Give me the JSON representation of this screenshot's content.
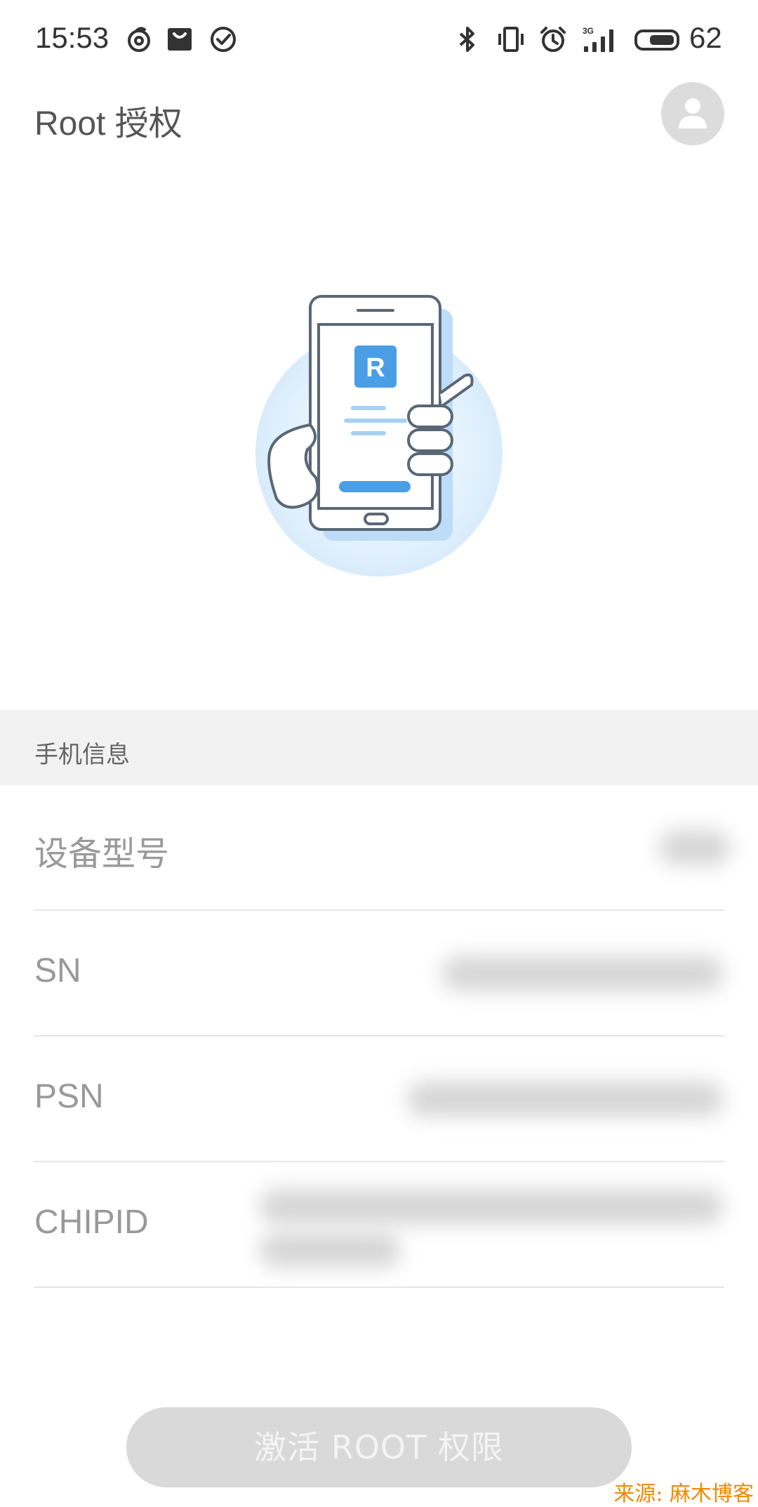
{
  "status_bar": {
    "time": "15:53",
    "battery": "62",
    "left_icons": [
      "netease-music-icon",
      "shopping-bag-icon",
      "check-circle-icon"
    ],
    "right_icons": [
      "bluetooth-icon",
      "vibrate-icon",
      "alarm-icon",
      "signal-3g-icon",
      "battery-icon"
    ]
  },
  "header": {
    "title": "Root 授权",
    "avatar_icon": "user-icon"
  },
  "illustration": {
    "badge_letter": "R",
    "accent": "#4a9ee6"
  },
  "section": {
    "title": "手机信息"
  },
  "info_rows": [
    {
      "label": "设备型号",
      "value": ""
    },
    {
      "label": "SN",
      "value": ""
    },
    {
      "label": "PSN",
      "value": ""
    },
    {
      "label": "CHIPID",
      "value": ""
    }
  ],
  "button": {
    "label": "激活 ROOT 权限",
    "enabled": false
  },
  "watermark": "来源: 麻木博客",
  "colors": {
    "accent": "#4a9ee6",
    "button_bg": "#d9d9d9",
    "section_bg": "#f2f2f2"
  }
}
